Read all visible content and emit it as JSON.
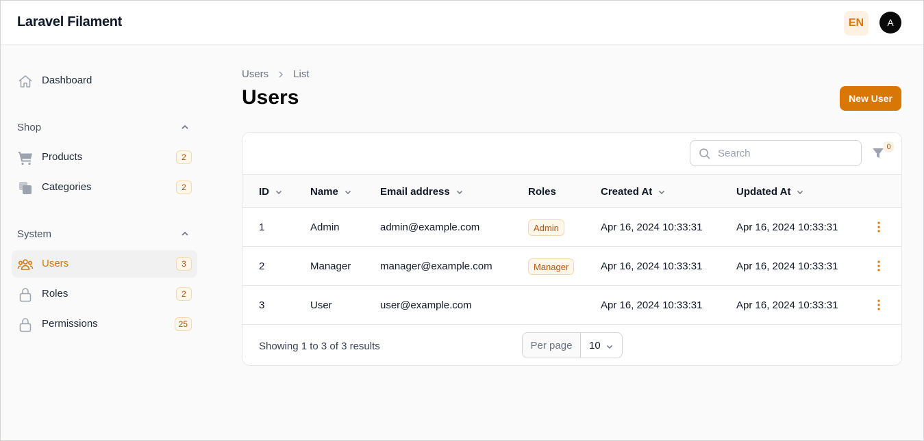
{
  "app": {
    "title": "Laravel Filament"
  },
  "header": {
    "lang": "EN",
    "avatar_initial": "A"
  },
  "sidebar": {
    "dashboard": {
      "label": "Dashboard",
      "icon": "home-icon"
    },
    "groups": [
      {
        "label": "Shop",
        "items": [
          {
            "label": "Products",
            "badge": "2",
            "icon": "cart-icon"
          },
          {
            "label": "Categories",
            "badge": "2",
            "icon": "stack-icon"
          }
        ]
      },
      {
        "label": "System",
        "items": [
          {
            "label": "Users",
            "badge": "3",
            "icon": "users-icon",
            "active": true
          },
          {
            "label": "Roles",
            "badge": "2",
            "icon": "lock-icon"
          },
          {
            "label": "Permissions",
            "badge": "25",
            "icon": "lock-icon"
          }
        ]
      }
    ]
  },
  "breadcrumb": [
    "Users",
    "List"
  ],
  "page": {
    "title": "Users",
    "new_button": "New User"
  },
  "table": {
    "search_placeholder": "Search",
    "filter_count": "0",
    "columns": [
      "ID",
      "Name",
      "Email address",
      "Roles",
      "Created At",
      "Updated At"
    ],
    "rows": [
      {
        "id": "1",
        "name": "Admin",
        "email": "admin@example.com",
        "role": "Admin",
        "created": "Apr 16, 2024 10:33:31",
        "updated": "Apr 16, 2024 10:33:31"
      },
      {
        "id": "2",
        "name": "Manager",
        "email": "manager@example.com",
        "role": "Manager",
        "created": "Apr 16, 2024 10:33:31",
        "updated": "Apr 16, 2024 10:33:31"
      },
      {
        "id": "3",
        "name": "User",
        "email": "user@example.com",
        "role": "",
        "created": "Apr 16, 2024 10:33:31",
        "updated": "Apr 16, 2024 10:33:31"
      }
    ],
    "footer": {
      "summary": "Showing 1 to 3 of 3 results",
      "per_page_label": "Per page",
      "per_page_value": "10"
    }
  },
  "colors": {
    "accent": "#d97706",
    "accent_soft": "#fdf1e3"
  }
}
